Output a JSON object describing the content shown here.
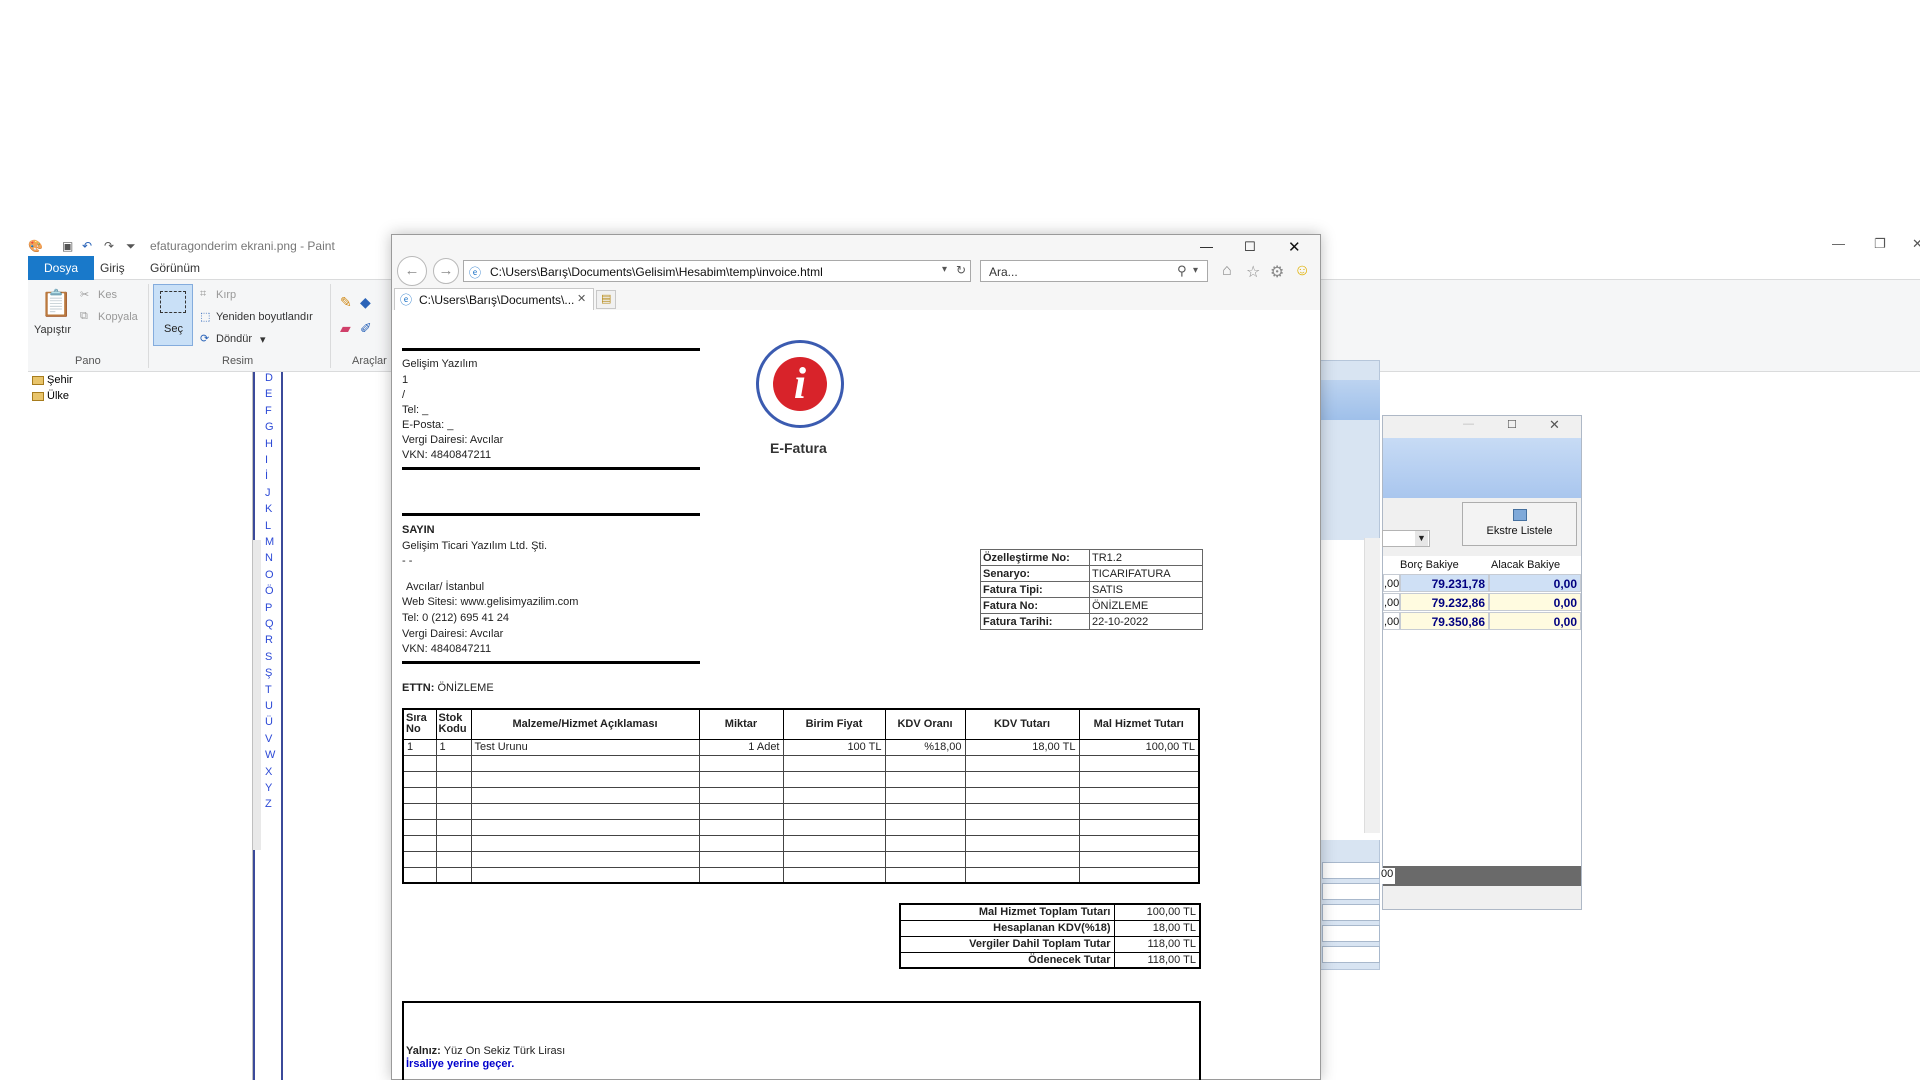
{
  "paint": {
    "title": "efaturagonderim ekrani.png - Paint",
    "tabs": [
      "Dosya",
      "Giriş",
      "Görünüm"
    ],
    "pano": {
      "paste": "Yapıştır",
      "cut": "Kes",
      "copy": "Kopyala",
      "label": "Pano"
    },
    "resim": {
      "select": "Seç",
      "crop": "Kırp",
      "resize": "Yeniden boyutlandır",
      "rotate": "Döndür",
      "label": "Resim"
    },
    "araclar": {
      "label": "Araçlar"
    },
    "tree": [
      "Şehir",
      "Ülke"
    ],
    "letters": [
      "D",
      "E",
      "F",
      "G",
      "H",
      "I",
      "İ",
      "J",
      "K",
      "L",
      "M",
      "N",
      "O",
      "Ö",
      "P",
      "Q",
      "R",
      "S",
      "Ş",
      "T",
      "U",
      "Ü",
      "V",
      "W",
      "X",
      "Y",
      "Z"
    ]
  },
  "ekstre": {
    "button": "Ekstre Listele",
    "headers": [
      "Borç Bakiye",
      "Alacak Bakiye"
    ],
    "left_stubs": [
      ",00",
      ",00",
      ",00"
    ],
    "rows": [
      {
        "borc": "79.231,78",
        "alacak": "0,00"
      },
      {
        "borc": "79.232,86",
        "alacak": "0,00"
      },
      {
        "borc": "79.350,86",
        "alacak": "0,00"
      }
    ],
    "status_stub": "00"
  },
  "browser": {
    "address": "C:\\Users\\Barış\\Documents\\Gelisim\\Hesabim\\temp\\invoice.html",
    "search_placeholder": "Ara...",
    "tab_title": "C:\\Users\\Barış\\Documents\\..."
  },
  "invoice": {
    "seller": {
      "name": "Gelişim Yazılım",
      "line2": "1",
      "line3": "/",
      "tel": "Tel: _",
      "email": "E-Posta: _",
      "tax_office": "Vergi Dairesi: Avcılar",
      "vkn": "VKN: 4840847211"
    },
    "logo_label": "E-Fatura",
    "buyer": {
      "heading": "SAYIN",
      "name": "Gelişim Ticari Yazılım Ltd. Şti.",
      "line2": "- -",
      "address": "Avcılar/ İstanbul",
      "web": "Web Sitesi: www.gelisimyazilim.com",
      "tel": "Tel: 0 (212) 695 41 24",
      "tax_office": "Vergi Dairesi: Avcılar",
      "vkn": "VKN: 4840847211"
    },
    "info": [
      {
        "k": "Özelleştirme No:",
        "v": "TR1.2"
      },
      {
        "k": "Senaryo:",
        "v": "TICARIFATURA"
      },
      {
        "k": "Fatura Tipi:",
        "v": "SATIS"
      },
      {
        "k": "Fatura No:",
        "v": "ÖNİZLEME"
      },
      {
        "k": "Fatura Tarihi:",
        "v": "22-10-2022"
      }
    ],
    "ettn_label": "ETTN:",
    "ettn_value": "ÖNİZLEME",
    "columns": [
      "Sıra No",
      "Stok Kodu",
      "Malzeme/Hizmet Açıklaması",
      "Miktar",
      "Birim Fiyat",
      "KDV Oranı",
      "KDV Tutarı",
      "Mal Hizmet Tutarı"
    ],
    "lines": [
      [
        "1",
        "1",
        "Test Urunu",
        "1 Adet",
        "100 TL",
        "%18,00",
        "18,00 TL",
        "100,00 TL"
      ]
    ],
    "totals": [
      {
        "k": "Mal Hizmet Toplam Tutarı",
        "v": "100,00 TL"
      },
      {
        "k": "Hesaplanan KDV(%18)",
        "v": "18,00 TL"
      },
      {
        "k": "Vergiler Dahil Toplam Tutar",
        "v": "118,00 TL"
      },
      {
        "k": "Ödenecek Tutar",
        "v": "118,00 TL"
      }
    ],
    "yalniz_label": "Yalnız:",
    "yalniz_value": "Yüz On Sekiz Türk Lirası",
    "irsaliye": "İrsaliye yerine geçer."
  }
}
